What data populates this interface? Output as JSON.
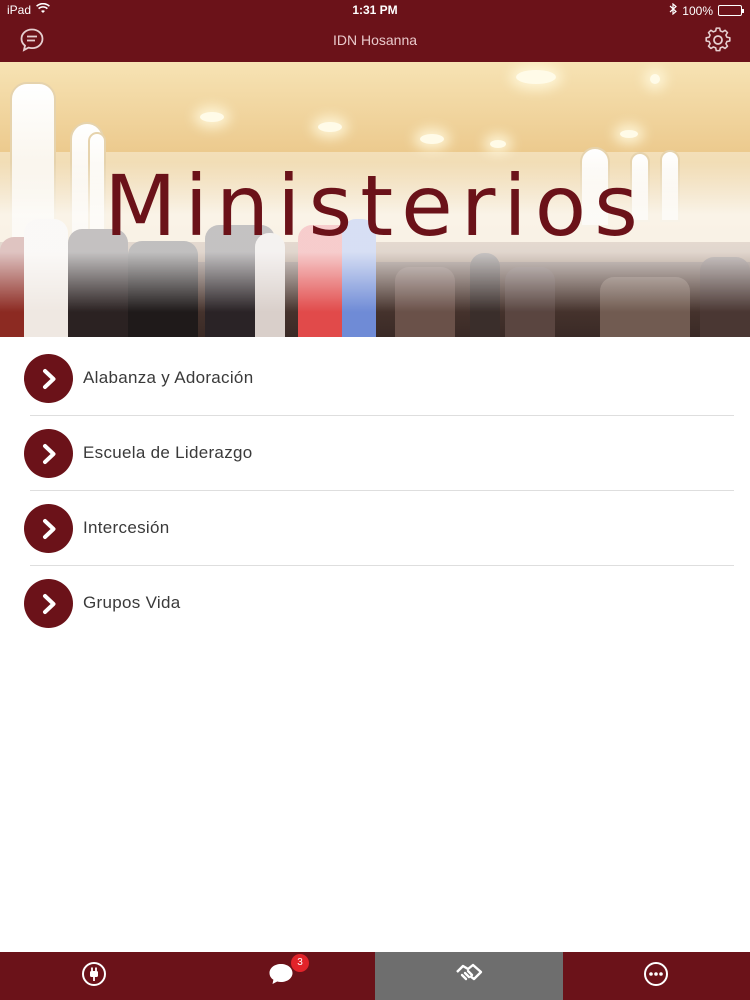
{
  "status_bar": {
    "device": "iPad",
    "time": "1:31 PM",
    "battery": "100%",
    "battery_level": 1.0
  },
  "nav": {
    "title": "IDN Hosanna",
    "left_icon": "chat-icon",
    "right_icon": "gear-icon"
  },
  "hero": {
    "title": "Ministerios"
  },
  "menu": {
    "items": [
      {
        "label": "Alabanza y Adoración",
        "icon": "chevron-right-icon"
      },
      {
        "label": "Escuela de Liderazgo",
        "icon": "chevron-right-icon"
      },
      {
        "label": "Intercesión",
        "icon": "chevron-right-icon"
      },
      {
        "label": "Grupos Vida",
        "icon": "chevron-right-icon"
      }
    ]
  },
  "tab_bar": {
    "tabs": [
      {
        "icon": "plug-icon",
        "active": false
      },
      {
        "icon": "speech-bubble-icon",
        "active": false,
        "badge": "3"
      },
      {
        "icon": "handshake-icon",
        "active": true
      },
      {
        "icon": "more-icon",
        "active": false
      }
    ]
  },
  "colors": {
    "brand": "#6b1219",
    "active_tab": "#6e6e6e",
    "badge": "#e2232a"
  }
}
